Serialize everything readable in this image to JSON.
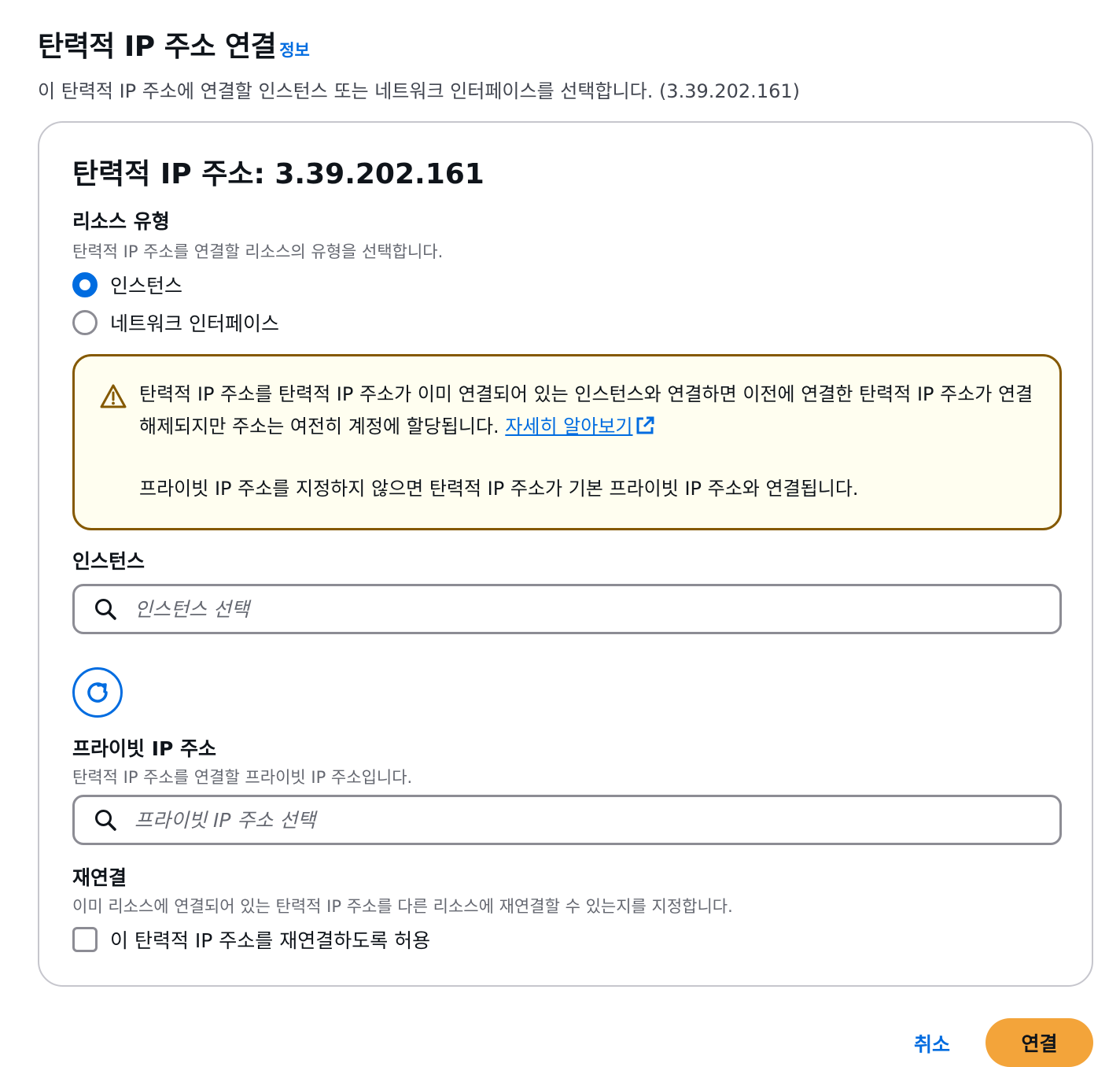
{
  "header": {
    "title": "탄력적 IP 주소 연결",
    "info_link": "정보",
    "description": "이 탄력적 IP 주소에 연결할 인스턴스 또는 네트워크 인터페이스를 선택합니다. (3.39.202.161)"
  },
  "panel": {
    "title": "탄력적 IP 주소: 3.39.202.161"
  },
  "resource_type": {
    "label": "리소스 유형",
    "description": "탄력적 IP 주소를 연결할 리소스의 유형을 선택합니다.",
    "options": [
      {
        "label": "인스턴스",
        "selected": true
      },
      {
        "label": "네트워크 인터페이스",
        "selected": false
      }
    ]
  },
  "alert": {
    "message_1": "탄력적 IP 주소를 탄력적 IP 주소가 이미 연결되어 있는 인스턴스와 연결하면 이전에 연결한 탄력적 IP 주소가 연결 해제되지만 주소는 여전히 계정에 할당됩니다.",
    "link_text": "자세히 알아보기",
    "message_2": "프라이빗 IP 주소를 지정하지 않으면 탄력적 IP 주소가 기본 프라이빗 IP 주소와 연결됩니다.",
    "icon": "warning-icon"
  },
  "instance": {
    "label": "인스턴스",
    "placeholder": "인스턴스 선택",
    "value": ""
  },
  "private_ip": {
    "label": "프라이빗 IP 주소",
    "description": "탄력적 IP 주소를 연결할 프라이빗 IP 주소입니다.",
    "placeholder": "프라이빗 IP 주소 선택",
    "value": ""
  },
  "reassociation": {
    "label": "재연결",
    "description": "이미 리소스에 연결되어 있는 탄력적 IP 주소를 다른 리소스에 재연결할 수 있는지를 지정합니다.",
    "checkbox_label": "이 탄력적 IP 주소를 재연결하도록 허용",
    "checked": false
  },
  "footer": {
    "cancel_label": "취소",
    "submit_label": "연결"
  },
  "colors": {
    "accent": "#006ce0",
    "primary_button": "#f3a43a",
    "warning_border": "#855900",
    "warning_background": "#fffef0"
  }
}
